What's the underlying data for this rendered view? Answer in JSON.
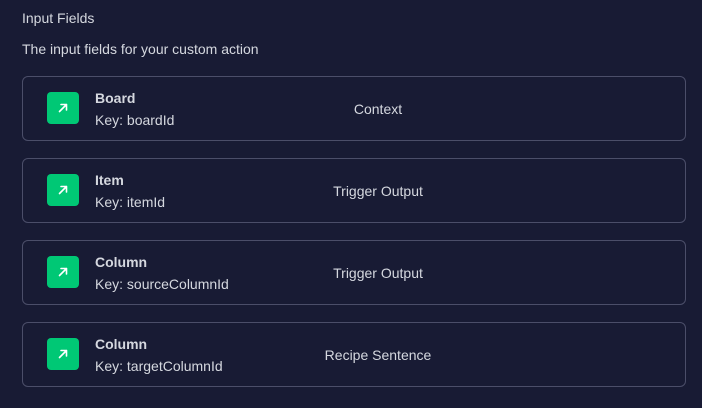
{
  "header": {
    "title": "Input Fields",
    "description": "The input fields for your custom action"
  },
  "fields": [
    {
      "name": "Board",
      "key": "Key: boardId",
      "source": "Context",
      "icon": "arrow-up-right-icon"
    },
    {
      "name": "Item",
      "key": "Key: itemId",
      "source": "Trigger Output",
      "icon": "arrow-up-right-icon"
    },
    {
      "name": "Column",
      "key": "Key: sourceColumnId",
      "source": "Trigger Output",
      "icon": "arrow-up-right-icon"
    },
    {
      "name": "Column",
      "key": "Key: targetColumnId",
      "source": "Recipe Sentence",
      "icon": "arrow-up-right-icon"
    }
  ],
  "colors": {
    "background": "#181b34",
    "card_border": "#4b4e69",
    "icon_accent": "#00c875",
    "text": "#d5d8df"
  }
}
